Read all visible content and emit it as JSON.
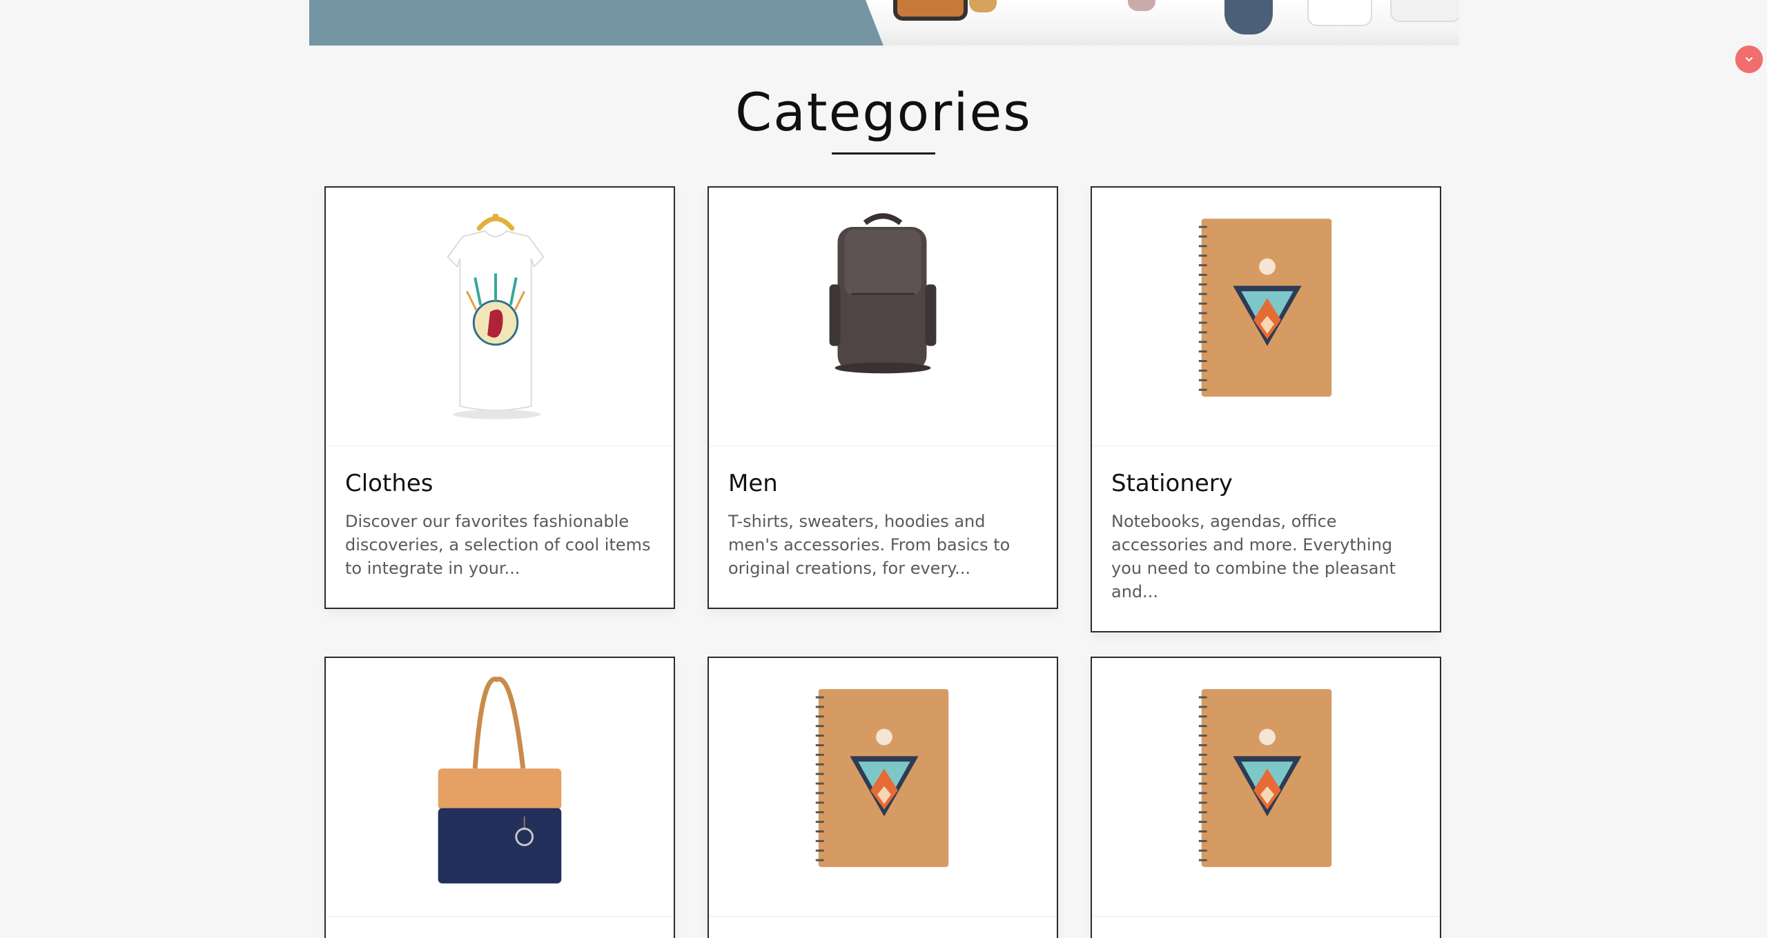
{
  "hero": {
    "image": "living-room-shelf-banner"
  },
  "scroll_button": {
    "icon": "chevron-down-icon",
    "color": "#f26d6d"
  },
  "section": {
    "title": "Categories"
  },
  "categories": [
    {
      "title": "Clothes",
      "description": "Discover our favorites fashionable discoveries, a selection of cool items to integrate in your...",
      "image": "t-shirt-on-hanger"
    },
    {
      "title": "Men",
      "description": "T-shirts, sweaters, hoodies and men's accessories. From basics to original creations, for every...",
      "image": "brown-backpack"
    },
    {
      "title": "Stationery",
      "description": "Notebooks, agendas, office accessories and more. Everything you need to combine the pleasant and...",
      "image": "fox-notebook"
    },
    {
      "title": "",
      "description": "",
      "image": "tote-bag"
    },
    {
      "title": "",
      "description": "",
      "image": "fox-notebook"
    },
    {
      "title": "",
      "description": "",
      "image": "fox-notebook"
    }
  ],
  "colors": {
    "page_background": "#f6f6f6",
    "card_border": "#2a2a2a",
    "hero_blue": "#7495a3",
    "accent_red": "#f26d6d"
  }
}
